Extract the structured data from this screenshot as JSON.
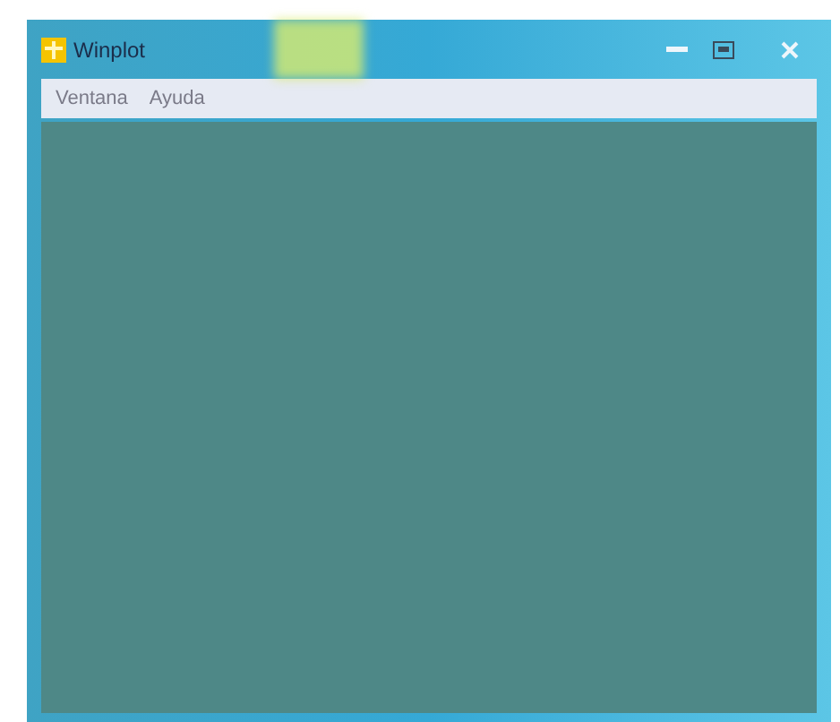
{
  "window": {
    "title": "Winplot"
  },
  "menu": [
    {
      "label": "Ventana"
    },
    {
      "label": "Ayuda"
    }
  ]
}
